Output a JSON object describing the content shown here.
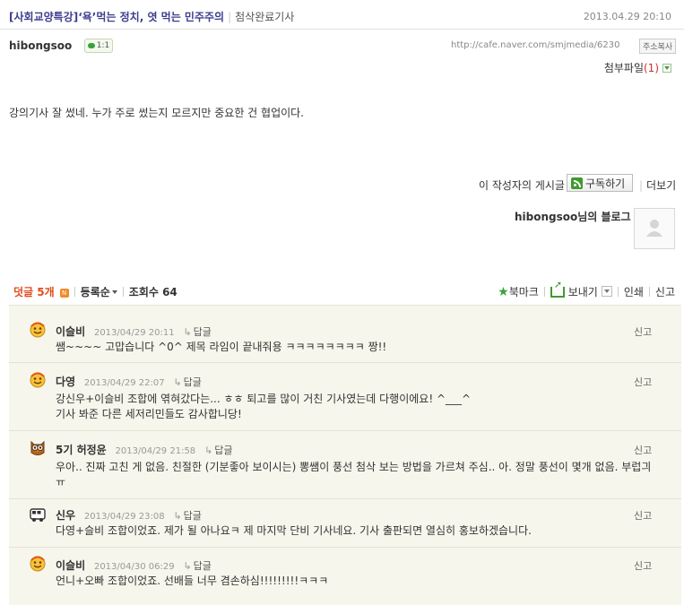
{
  "post": {
    "title": "[사회교양특강]‘욕’먹는 정치, 엿 먹는 민주주의",
    "category": "첨삭완료기사",
    "date": "2013.04.29 20:10",
    "author": "hibongsoo",
    "chat_badge": "1:1",
    "url": "http://cafe.naver.com/smjmedia/6230",
    "copy_address": "주소복사",
    "attach_label": "첨부파일",
    "attach_count": "(1)",
    "body": "강의기사 잘 썼네. 누가 주로 썼는지 모르지만 중요한 건 협업이다."
  },
  "author_box": {
    "posts_label": "이 작성자의 게시글",
    "subscribe": "구독하기",
    "more": "더보기",
    "blog_label": "hibongsoo님의 블로그"
  },
  "toolbar": {
    "comments_label": "덧글 5개",
    "n_badge": "N",
    "sort": "등록순",
    "views": "조회수 64",
    "bookmark": "북마크",
    "send": "보내기",
    "print": "인쇄",
    "report": "신고"
  },
  "comments": [
    {
      "name": "이슬비",
      "date": "2013/04/29 20:11",
      "reply": "답글",
      "report": "신고",
      "icon": "smiley-icon",
      "text": "쌤~~~~ 고맙습니다 ^0^ 제목 라임이 끝내줘용 ㅋㅋㅋㅋㅋㅋㅋㅋ 짱!!"
    },
    {
      "name": "다영",
      "date": "2013/04/29 22:07",
      "reply": "답글",
      "report": "신고",
      "icon": "smiley-icon",
      "text": "강신우+이슬비 조합에 엮혀갔다는... ㅎㅎ 퇴고를 많이 거친 기사였는데 다행이에요! ^___^\n기사 봐준 다른 세저리민들도 감사합니당!"
    },
    {
      "name": "5기 허정윤",
      "date": "2013/04/29 21:58",
      "reply": "답글",
      "report": "신고",
      "icon": "owl-icon",
      "text": "우아.. 진짜 고친 게 없음. 친절한 (기분좋아 보이시는) 뽕쌤이 풍선 첨삭 보는 방법을 가르쳐 주심.. 아. 정말 풍선이 몇개 없음. 부럽긔 ㅠ"
    },
    {
      "name": "신우",
      "date": "2013/04/29 23:08",
      "reply": "답글",
      "report": "신고",
      "icon": "bus-icon",
      "text": "다영+슬비 조합이었죠. 제가 될 아나요ㅋ 제 마지막 단비 기사네요. 기사 출판되면 열심히 홍보하겠습니다."
    },
    {
      "name": "이슬비",
      "date": "2013/04/30 06:29",
      "reply": "답글",
      "report": "신고",
      "icon": "smiley-icon",
      "text": "언니+오빠 조합이었죠. 선배들 너무 겸손하심!!!!!!!!!ㅋㅋㅋ"
    }
  ]
}
